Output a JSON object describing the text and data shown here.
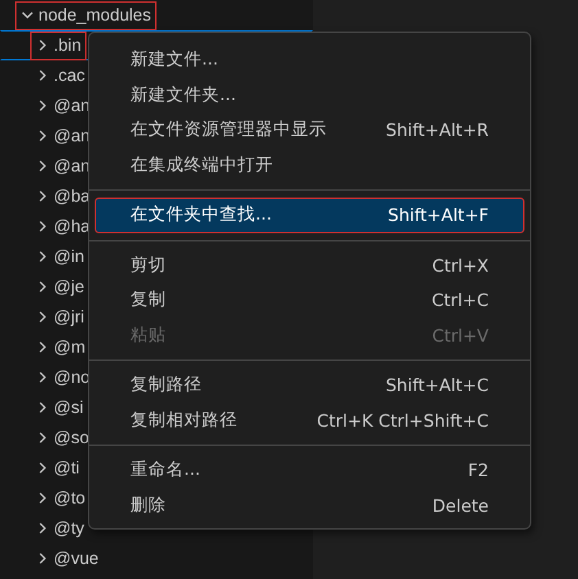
{
  "explorer": {
    "tree": [
      {
        "name": "node_modules",
        "expanded": true,
        "marked": true,
        "selected": false,
        "children": [
          {
            "name": ".bin",
            "expanded": false,
            "marked": true,
            "selected": true
          },
          {
            "name": ".cac",
            "expanded": false,
            "marked": false,
            "selected": false
          },
          {
            "name": "@an",
            "expanded": false,
            "marked": false,
            "selected": false
          },
          {
            "name": "@an",
            "expanded": false,
            "marked": false,
            "selected": false
          },
          {
            "name": "@an",
            "expanded": false,
            "marked": false,
            "selected": false
          },
          {
            "name": "@ba",
            "expanded": false,
            "marked": false,
            "selected": false
          },
          {
            "name": "@ha",
            "expanded": false,
            "marked": false,
            "selected": false
          },
          {
            "name": "@in",
            "expanded": false,
            "marked": false,
            "selected": false
          },
          {
            "name": "@je",
            "expanded": false,
            "marked": false,
            "selected": false
          },
          {
            "name": "@jri",
            "expanded": false,
            "marked": false,
            "selected": false
          },
          {
            "name": "@m",
            "expanded": false,
            "marked": false,
            "selected": false
          },
          {
            "name": "@no",
            "expanded": false,
            "marked": false,
            "selected": false
          },
          {
            "name": "@si",
            "expanded": false,
            "marked": false,
            "selected": false
          },
          {
            "name": "@so",
            "expanded": false,
            "marked": false,
            "selected": false
          },
          {
            "name": "@ti",
            "expanded": false,
            "marked": false,
            "selected": false
          },
          {
            "name": "@to",
            "expanded": false,
            "marked": false,
            "selected": false
          },
          {
            "name": "@ty",
            "expanded": false,
            "marked": false,
            "selected": false
          },
          {
            "name": "@vue",
            "expanded": false,
            "marked": false,
            "selected": false
          }
        ]
      }
    ]
  },
  "context_menu": {
    "items": [
      {
        "kind": "item",
        "label": "新建文件...",
        "selected": false,
        "disabled": false
      },
      {
        "kind": "item",
        "label": "新建文件夹...",
        "selected": false,
        "disabled": false
      },
      {
        "kind": "item",
        "label": "在文件资源管理器中显示",
        "shortcut": "Shift+Alt+R",
        "selected": false,
        "disabled": false
      },
      {
        "kind": "item",
        "label": "在集成终端中打开",
        "selected": false,
        "disabled": false
      },
      {
        "kind": "separator"
      },
      {
        "kind": "item",
        "label": "在文件夹中查找...",
        "shortcut": "Shift+Alt+F",
        "selected": true,
        "marked": true,
        "disabled": false
      },
      {
        "kind": "separator"
      },
      {
        "kind": "item",
        "label": "剪切",
        "shortcut": "Ctrl+X",
        "selected": false,
        "disabled": false
      },
      {
        "kind": "item",
        "label": "复制",
        "shortcut": "Ctrl+C",
        "selected": false,
        "disabled": false
      },
      {
        "kind": "item",
        "label": "粘贴",
        "shortcut": "Ctrl+V",
        "selected": false,
        "disabled": true
      },
      {
        "kind": "separator"
      },
      {
        "kind": "item",
        "label": "复制路径",
        "shortcut": "Shift+Alt+C",
        "selected": false,
        "disabled": false
      },
      {
        "kind": "item",
        "label": "复制相对路径",
        "shortcut": "Ctrl+K Ctrl+Shift+C",
        "selected": false,
        "disabled": false
      },
      {
        "kind": "separator"
      },
      {
        "kind": "item",
        "label": "重命名...",
        "shortcut": "F2",
        "selected": false,
        "disabled": false
      },
      {
        "kind": "item",
        "label": "删除",
        "shortcut": "Delete",
        "selected": false,
        "disabled": false
      }
    ]
  }
}
